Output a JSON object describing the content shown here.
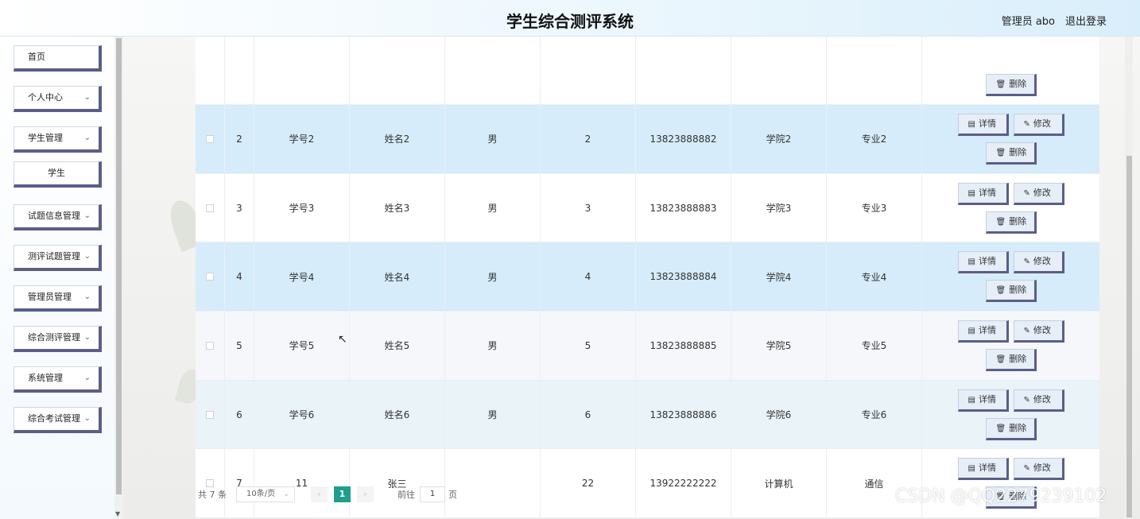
{
  "header": {
    "title": "学生综合测评系统",
    "user": "管理员 abo",
    "logout": "退出登录"
  },
  "sidebar": {
    "items": [
      {
        "label": "首页",
        "chevron": false,
        "sub": false
      },
      {
        "label": "个人中心",
        "chevron": true,
        "sub": false
      },
      {
        "label": "学生管理",
        "chevron": true,
        "sub": false
      },
      {
        "label": "学生",
        "chevron": false,
        "sub": true
      },
      {
        "label": "试题信息管理",
        "chevron": true,
        "sub": false
      },
      {
        "label": "测评试题管理",
        "chevron": true,
        "sub": false
      },
      {
        "label": "管理员管理",
        "chevron": true,
        "sub": false
      },
      {
        "label": "综合测评管理",
        "chevron": true,
        "sub": false
      },
      {
        "label": "系统管理",
        "chevron": true,
        "sub": false
      },
      {
        "label": "综合考试管理",
        "chevron": true,
        "sub": false
      }
    ]
  },
  "actions": {
    "detail": "详情",
    "edit": "修改",
    "delete": "删除"
  },
  "rows": [
    {
      "index": "2",
      "no": "学号2",
      "name": "姓名2",
      "sex": "男",
      "age": "2",
      "phone": "13823888882",
      "college": "学院2",
      "major": "专业2"
    },
    {
      "index": "3",
      "no": "学号3",
      "name": "姓名3",
      "sex": "男",
      "age": "3",
      "phone": "13823888883",
      "college": "学院3",
      "major": "专业3"
    },
    {
      "index": "4",
      "no": "学号4",
      "name": "姓名4",
      "sex": "男",
      "age": "4",
      "phone": "13823888884",
      "college": "学院4",
      "major": "专业4"
    },
    {
      "index": "5",
      "no": "学号5",
      "name": "姓名5",
      "sex": "男",
      "age": "5",
      "phone": "13823888885",
      "college": "学院5",
      "major": "专业5"
    },
    {
      "index": "6",
      "no": "学号6",
      "name": "姓名6",
      "sex": "男",
      "age": "6",
      "phone": "13823888886",
      "college": "学院6",
      "major": "专业6"
    },
    {
      "index": "7",
      "no": "11",
      "name": "张三",
      "sex": "",
      "age": "22",
      "phone": "13922222222",
      "college": "计算机",
      "major": "通信"
    }
  ],
  "pagination": {
    "total": "共 7 条",
    "page_size": "10条/页",
    "current": "1",
    "goto_label": "前往",
    "goto_value": "1",
    "page_suffix": "页"
  },
  "watermark": "CSDN @QQ2279239102"
}
